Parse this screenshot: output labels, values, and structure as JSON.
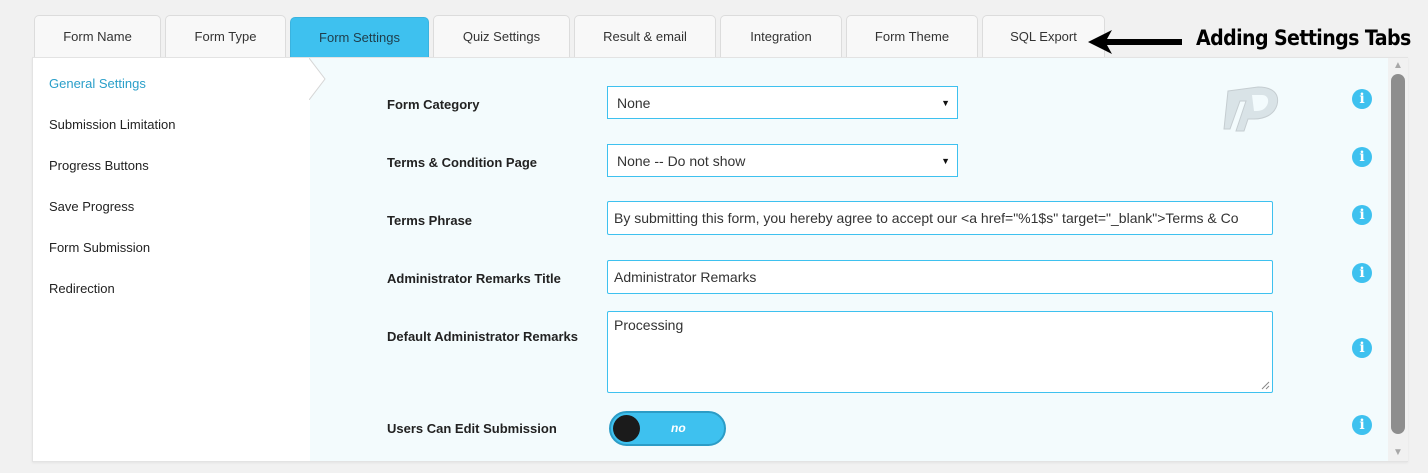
{
  "tabs": [
    {
      "label": "Form Name"
    },
    {
      "label": "Form Type"
    },
    {
      "label": "Form Settings"
    },
    {
      "label": "Quiz Settings"
    },
    {
      "label": "Result & email"
    },
    {
      "label": "Integration"
    },
    {
      "label": "Form Theme"
    },
    {
      "label": "SQL Export"
    }
  ],
  "active_tab": "Form Settings",
  "annotation": {
    "text": "Adding Settings Tabs"
  },
  "sidebar": {
    "items": [
      {
        "label": "General Settings"
      },
      {
        "label": "Submission Limitation"
      },
      {
        "label": "Progress Buttons"
      },
      {
        "label": "Save Progress"
      },
      {
        "label": "Form Submission"
      },
      {
        "label": "Redirection"
      }
    ],
    "active": "General Settings"
  },
  "fields": {
    "form_category": {
      "label": "Form Category",
      "value": "None"
    },
    "terms_page": {
      "label": "Terms & Condition Page",
      "value": "None -- Do not show"
    },
    "terms_phrase": {
      "label": "Terms Phrase",
      "value": "By submitting this form, you hereby agree to accept our <a href=\"%1$s\" target=\"_blank\">Terms & Co"
    },
    "admin_remarks_title": {
      "label": "Administrator Remarks Title",
      "value": "Administrator Remarks"
    },
    "default_admin_remarks": {
      "label": "Default Administrator Remarks",
      "value": "Processing"
    },
    "users_can_edit": {
      "label": "Users Can Edit Submission",
      "value": "no"
    }
  },
  "info_icon_glyph": "i",
  "colors": {
    "accent": "#3ec1ef",
    "active_sidebar_text": "#2a9fc9",
    "content_bg": "#f3fbfd",
    "toggle_knob": "#1b1b1b"
  }
}
